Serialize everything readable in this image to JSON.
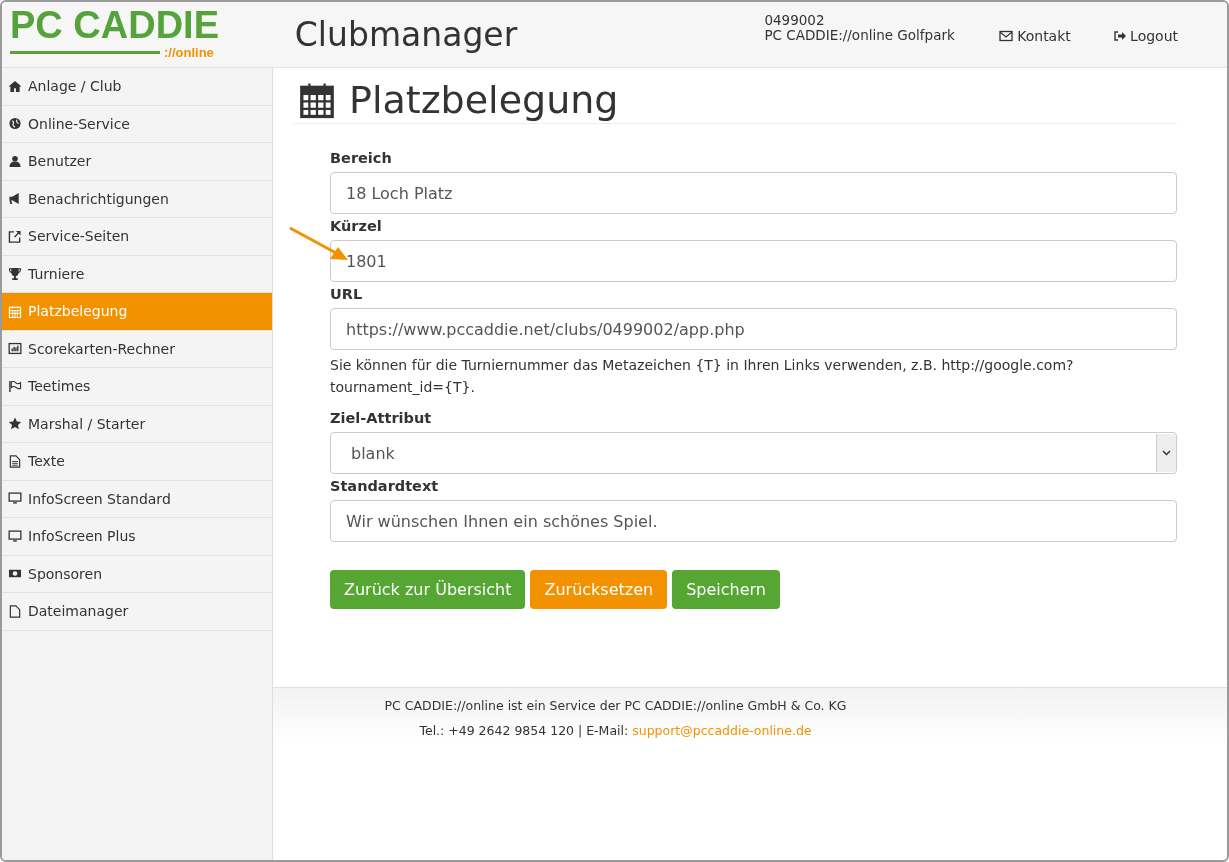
{
  "header": {
    "logo": {
      "name": "PC CADDIE",
      "suffix": "://online"
    },
    "title": "Clubmanager",
    "account_id": "0499002",
    "account_name": "PC CADDIE://online Golfpark",
    "links": [
      {
        "label": "Kontakt"
      },
      {
        "label": "Logout"
      }
    ]
  },
  "sidebar": {
    "items": [
      {
        "label": "Anlage / Club",
        "selected": false
      },
      {
        "label": "Online-Service",
        "selected": false
      },
      {
        "label": "Benutzer",
        "selected": false
      },
      {
        "label": "Benachrichtigungen",
        "selected": false
      },
      {
        "label": "Service-Seiten",
        "selected": false
      },
      {
        "label": "Turniere",
        "selected": false
      },
      {
        "label": "Platzbelegung",
        "selected": true
      },
      {
        "label": "Scorekarten-Rechner",
        "selected": false
      },
      {
        "label": "Teetimes",
        "selected": false
      },
      {
        "label": "Marshal / Starter",
        "selected": false
      },
      {
        "label": "Texte",
        "selected": false
      },
      {
        "label": "InfoScreen Standard",
        "selected": false
      },
      {
        "label": "InfoScreen Plus",
        "selected": false
      },
      {
        "label": "Sponsoren",
        "selected": false
      },
      {
        "label": "Dateimanager",
        "selected": false
      }
    ]
  },
  "page": {
    "title": "Platzbelegung",
    "fields": [
      {
        "kind": "text",
        "label": "Bereich",
        "value": "18 Loch Platz"
      },
      {
        "kind": "text",
        "label": "Kürzel",
        "value": "1801",
        "highlighted": true
      },
      {
        "kind": "text",
        "label": "URL",
        "value": "https://www.pccaddie.net/clubs/0499002/app.php",
        "help": "Sie können für die Turniernummer das Metazeichen {T} in Ihren Links verwenden, z.B. http://google.com?tournament_id={T}."
      },
      {
        "kind": "select",
        "label": "Ziel-Attribut",
        "value": "blank"
      },
      {
        "kind": "text",
        "label": "Standardtext",
        "value": "Wir wünschen Ihnen ein schönes Spiel."
      }
    ],
    "buttons": [
      {
        "kind": "success",
        "label": "Zurück zur Übersicht"
      },
      {
        "kind": "warning",
        "label": "Zurücksetzen"
      },
      {
        "kind": "success",
        "label": "Speichern"
      }
    ]
  },
  "footer": {
    "line1": "PC CADDIE://online ist ein Service der PC CADDIE://online GmbH & Co. KG",
    "line2": "Tel.: +49 2642 9854 120 | E-Mail:",
    "email": "support@pccaddie-online.de"
  }
}
